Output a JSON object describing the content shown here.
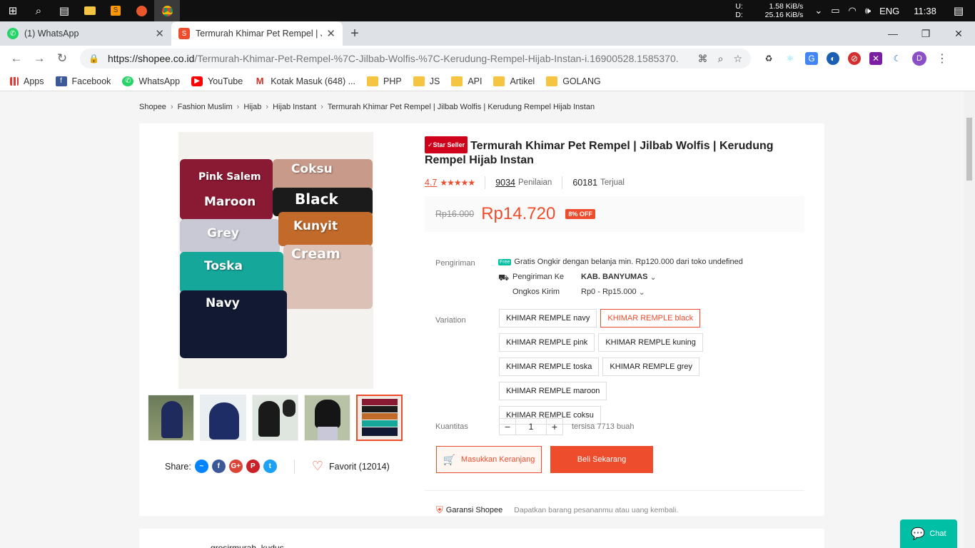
{
  "taskbar": {
    "net_up_label": "U:",
    "net_up": "1.58 KiB/s",
    "net_down_label": "D:",
    "net_down": "25.16 KiB/s",
    "lang": "ENG",
    "time": "11:38"
  },
  "tabs": [
    {
      "title": "(1) WhatsApp"
    },
    {
      "title": "Termurah Khimar Pet Rempel | Jilbab Wolfis | Kerudung Rempel Hijab Instan"
    }
  ],
  "omnibox": {
    "host": "https://shopee.co.id",
    "path": "/Termurah-Khimar-Pet-Rempel-%7C-Jilbab-Wolfis-%7C-Kerudung-Rempel-Hijab-Instan-i.16900528.1585370..."
  },
  "profile_initial": "D",
  "bookmarks": [
    {
      "label": "Apps",
      "icon": "apps-icon"
    },
    {
      "label": "Facebook",
      "icon": "facebook-icon"
    },
    {
      "label": "WhatsApp",
      "icon": "whatsapp-icon"
    },
    {
      "label": "YouTube",
      "icon": "youtube-icon"
    },
    {
      "label": "Kotak Masuk (648) ...",
      "icon": "gmail-icon"
    },
    {
      "label": "PHP",
      "icon": "folder-icon"
    },
    {
      "label": "JS",
      "icon": "folder-icon"
    },
    {
      "label": "API",
      "icon": "folder-icon"
    },
    {
      "label": "Artikel",
      "icon": "folder-icon"
    },
    {
      "label": "GOLANG",
      "icon": "folder-icon"
    }
  ],
  "breadcrumb": [
    "Shopee",
    "Fashion Muslim",
    "Hijab",
    "Hijab Instant",
    "Termurah Khimar Pet Rempel | Jilbab Wolfis | Kerudung Rempel Hijab Instan"
  ],
  "product": {
    "badge": "Star Seller",
    "title": "Termurah Khimar Pet Rempel | Jilbab Wolfis | Kerudung Rempel Hijab Instan",
    "rating": "4.7",
    "rating_stars": 5,
    "reviews_count": "9034",
    "reviews_label": "Penilaian",
    "sold_count": "60181",
    "sold_label": "Terjual",
    "old_price": "Rp16.000",
    "price": "Rp14.720",
    "discount": "8% OFF",
    "image_labels": [
      "Pink Salem",
      "Coksu",
      "Maroon",
      "Black",
      "Grey",
      "Kunyit",
      "Toska",
      "Cream",
      "Navy"
    ]
  },
  "shipping": {
    "label": "Pengiriman",
    "free_badge": "Free",
    "free_text": "Gratis Ongkir dengan belanja min. Rp120.000 dari toko undefined",
    "to_label": "Pengiriman Ke",
    "to_value": "KAB. BANYUMAS",
    "cost_label": "Ongkos Kirim",
    "cost_value": "Rp0 - Rp15.000"
  },
  "variation": {
    "label": "Variation",
    "options": [
      "KHIMAR REMPLE navy",
      "KHIMAR REMPLE black",
      "KHIMAR REMPLE pink",
      "KHIMAR REMPLE kuning",
      "KHIMAR REMPLE toska",
      "KHIMAR REMPLE grey",
      "KHIMAR REMPLE maroon",
      "KHIMAR REMPLE coksu"
    ],
    "selected": "KHIMAR REMPLE black"
  },
  "quantity": {
    "label": "Kuantitas",
    "value": "1",
    "stock": "tersisa 7713 buah"
  },
  "actions": {
    "cart": "Masukkan Keranjang",
    "buy": "Beli Sekarang"
  },
  "share": {
    "label": "Share:",
    "favorite": "Favorit (12014)"
  },
  "guarantee": {
    "title": "Garansi Shopee",
    "desc": "Dapatkan barang pesananmu atau uang kembali."
  },
  "seller": {
    "name": "grosirmurah_kudus"
  },
  "chat": {
    "label": "Chat"
  },
  "colors": {
    "accent": "#ee4d2d",
    "teal": "#00bfa5"
  }
}
